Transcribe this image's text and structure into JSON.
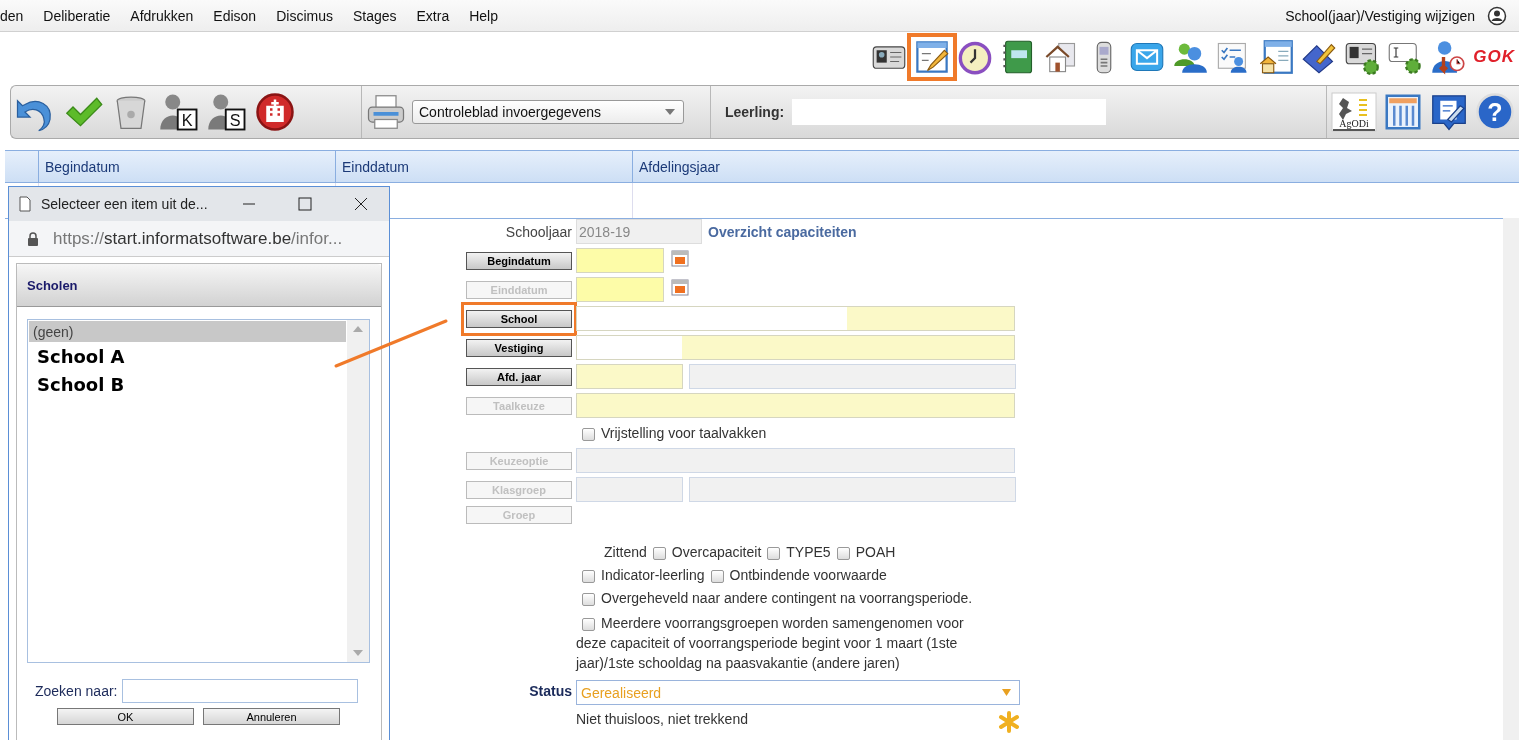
{
  "menu_bar": {
    "items": [
      "den",
      "Deliberatie",
      "Afdrukken",
      "Edison",
      "Discimus",
      "Stages",
      "Extra",
      "Help"
    ],
    "school_switch": "School(jaar)/Vestiging wijzigen"
  },
  "top_toolbar": [
    {
      "kind": "id-card",
      "highlighted": false
    },
    {
      "kind": "form-pencil",
      "highlighted": true
    },
    {
      "kind": "clock",
      "highlighted": false
    },
    {
      "kind": "notebook",
      "highlighted": false
    },
    {
      "kind": "house",
      "highlighted": false
    },
    {
      "kind": "phone",
      "highlighted": false
    },
    {
      "kind": "mail",
      "highlighted": false
    },
    {
      "kind": "users",
      "highlighted": false
    },
    {
      "kind": "checklist-user",
      "highlighted": false
    },
    {
      "kind": "house-document",
      "highlighted": false
    },
    {
      "kind": "pencil-book",
      "highlighted": false
    },
    {
      "kind": "id-card-gear",
      "highlighted": false
    },
    {
      "kind": "text-gear",
      "highlighted": false
    },
    {
      "kind": "user-clock",
      "highlighted": false
    },
    {
      "kind": "logo-text",
      "text": "GOK",
      "highlighted": false
    }
  ],
  "action_toolbar": {
    "left_icons": [
      {
        "kind": "undo"
      },
      {
        "kind": "checkmark"
      },
      {
        "kind": "trash-can"
      },
      {
        "kind": "user-letter",
        "letter": "K"
      },
      {
        "kind": "user-letter",
        "letter": "S"
      },
      {
        "kind": "hospital"
      }
    ],
    "report_dropdown": "Controleblad invoergegevens",
    "student_label": "Leerling:",
    "right_icons": [
      {
        "kind": "agodi-logo",
        "text": "AgODi"
      },
      {
        "kind": "columns"
      },
      {
        "kind": "document-edit"
      },
      {
        "kind": "help",
        "glyph": "?"
      }
    ]
  },
  "table": {
    "columns": [
      "Begindatum",
      "Einddatum",
      "Afdelingsjaar"
    ]
  },
  "form": {
    "school_year_label": "Schooljaar",
    "school_year": "2018-19",
    "title": "Overzicht capaciteiten",
    "rows": [
      {
        "kind": "date",
        "button": "Begindatum",
        "disabled": false,
        "highlighted": false
      },
      {
        "kind": "date",
        "button": "Einddatum",
        "disabled": true,
        "highlighted": false
      },
      {
        "kind": "wide-long-value",
        "button": "School",
        "disabled": false,
        "highlighted": true
      },
      {
        "kind": "wide-short-value",
        "button": "Vestiging",
        "disabled": false,
        "highlighted": false
      },
      {
        "kind": "split",
        "button": "Afd. jaar",
        "disabled": false,
        "highlighted": false
      },
      {
        "kind": "wide",
        "button": "Taalkeuze",
        "disabled": true,
        "highlighted": false
      },
      {
        "kind": "checkbox",
        "label": "Vrijstelling voor taalvakken",
        "checked": false
      },
      {
        "kind": "grey",
        "button": "Keuzeoptie",
        "disabled": true,
        "highlighted": false
      },
      {
        "kind": "grey-split",
        "button": "Klasgroep",
        "disabled": true,
        "highlighted": false
      },
      {
        "kind": "none",
        "button": "Groep",
        "disabled": true,
        "highlighted": false
      }
    ],
    "option_lines": [
      [
        {
          "kind": "text",
          "label": "Zittend"
        },
        {
          "kind": "checkbox",
          "checked": false
        },
        {
          "kind": "text",
          "label": "Overcapaciteit"
        },
        {
          "kind": "checkbox",
          "checked": false
        },
        {
          "kind": "text",
          "label": "TYPE5"
        },
        {
          "kind": "checkbox",
          "checked": false
        },
        {
          "kind": "text",
          "label": "POAH"
        }
      ],
      [
        {
          "kind": "checkbox",
          "checked": false
        },
        {
          "kind": "text",
          "label": "Indicator-leerling"
        },
        {
          "kind": "checkbox",
          "checked": false
        },
        {
          "kind": "text",
          "label": "Ontbindende voorwaarde"
        }
      ],
      [
        {
          "kind": "checkbox",
          "checked": false
        },
        {
          "kind": "text",
          "label": "Overgeheveld naar andere contingent na voorrangsperiode."
        }
      ]
    ],
    "merge_option": {
      "checked": false,
      "label": "Meerdere voorrangsgroepen worden samengenomen voor",
      "continuation": "deze capaciteit of voorrangsperiode begint voor 1 maart (1ste jaar)/1ste schooldag na paasvakantie (andere jaren)"
    },
    "status_label": "Status",
    "status": "Gerealiseerd",
    "note": "Niet thuisloos, niet trekkend"
  },
  "popup": {
    "title": "Selecteer een item uit de...",
    "url": {
      "scheme": "https://",
      "host": "start.informatsoftware.be",
      "path": "/infor..."
    },
    "panel_title": "Scholen",
    "items": [
      {
        "kind": "none",
        "label": "(geen)",
        "selected": true
      },
      {
        "kind": "entry",
        "label": "School A",
        "selected": false
      },
      {
        "kind": "entry",
        "label": "School B",
        "selected": false
      }
    ],
    "search_label": "Zoeken naar:",
    "buttons": [
      "OK",
      "Annuleren"
    ]
  }
}
